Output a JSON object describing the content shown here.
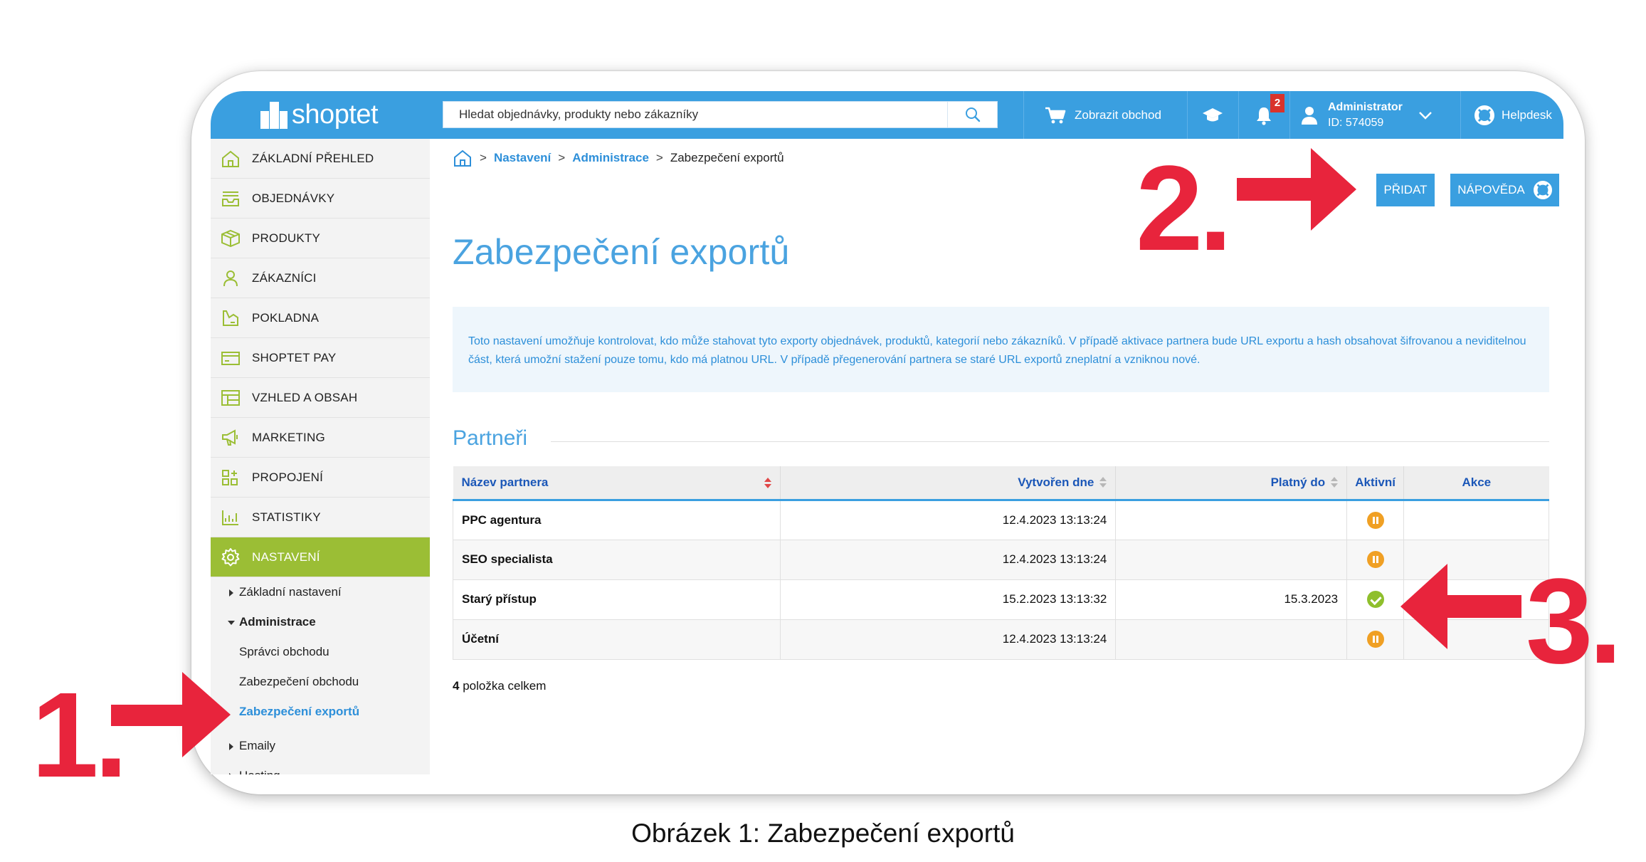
{
  "app": {
    "logo_text": "shoptet",
    "search_placeholder": "Hledat objednávky, produkty nebo zákazníky",
    "show_store_label": "Zobrazit obchod",
    "notification_count": "2",
    "user_name": "Administrator",
    "user_id": "ID: 574059",
    "helpdesk_label": "Helpdesk"
  },
  "sidebar": {
    "items": [
      {
        "label": "ZÁKLADNÍ PŘEHLED",
        "icon": "home-icon"
      },
      {
        "label": "OBJEDNÁVKY",
        "icon": "inbox-icon"
      },
      {
        "label": "PRODUKTY",
        "icon": "box-icon"
      },
      {
        "label": "ZÁKAZNÍCI",
        "icon": "user-icon"
      },
      {
        "label": "POKLADNA",
        "icon": "register-icon"
      },
      {
        "label": "SHOPTET PAY",
        "icon": "card-icon"
      },
      {
        "label": "VZHLED A OBSAH",
        "icon": "layout-icon"
      },
      {
        "label": "MARKETING",
        "icon": "megaphone-icon"
      },
      {
        "label": "PROPOJENÍ",
        "icon": "plugins-icon"
      },
      {
        "label": "STATISTIKY",
        "icon": "chart-icon"
      },
      {
        "label": "NASTAVENÍ",
        "icon": "gear-icon",
        "active": true
      }
    ],
    "sub": {
      "zakladni": "Základní nastavení",
      "administrace": "Administrace",
      "spravci": "Správci obchodu",
      "zabezpeceni_obchodu": "Zabezpečení obchodu",
      "zabezpeceni_exportu": "Zabezpečení exportů",
      "emaily": "Emaily",
      "hosting": "Hosting"
    }
  },
  "breadcrumb": {
    "sep": ">",
    "level1": "Nastavení",
    "level2": "Administrace",
    "current": "Zabezpečení exportů"
  },
  "actions": {
    "add": "PŘIDAT",
    "help": "NÁPOVĚDA"
  },
  "page": {
    "title": "Zabezpečení exportů",
    "info": "Toto nastavení umožňuje kontrolovat, kdo může stahovat tyto exporty objednávek, produktů, kategorií nebo zákazníků. V případě aktivace partnera bude URL exportu a hash obsahovat šifrovanou a neviditelnou část, která umožní stažení pouze tomu, kdo má platnou URL. V případě přegenerování partnera se staré URL exportů zneplatní a vzniknou nové.",
    "section_title": "Partneři",
    "count_num": "4",
    "count_text": "položka celkem"
  },
  "table": {
    "headers": [
      "Název partnera",
      "Vytvořen dne",
      "Platný do",
      "Aktivní",
      "Akce"
    ],
    "rows": [
      {
        "name": "PPC agentura",
        "created": "12.4.2023 13:13:24",
        "valid": "",
        "status": "paused"
      },
      {
        "name": "SEO specialista",
        "created": "12.4.2023 13:13:24",
        "valid": "",
        "status": "paused"
      },
      {
        "name": "Starý přístup",
        "created": "15.2.2023 13:13:32",
        "valid": "15.3.2023",
        "status": "active"
      },
      {
        "name": "Účetní",
        "created": "12.4.2023 13:13:24",
        "valid": "",
        "status": "paused"
      }
    ]
  },
  "annotations": {
    "one": "1.",
    "two": "2.",
    "three": "3.",
    "color": "#e8243c"
  },
  "caption": "Obrázek 1: Zabezpečení exportů",
  "colors": {
    "topbar": "#3a9fe0",
    "sidebar_active": "#9bbe35",
    "link": "#1b57b8",
    "title": "#4aa3e0"
  }
}
